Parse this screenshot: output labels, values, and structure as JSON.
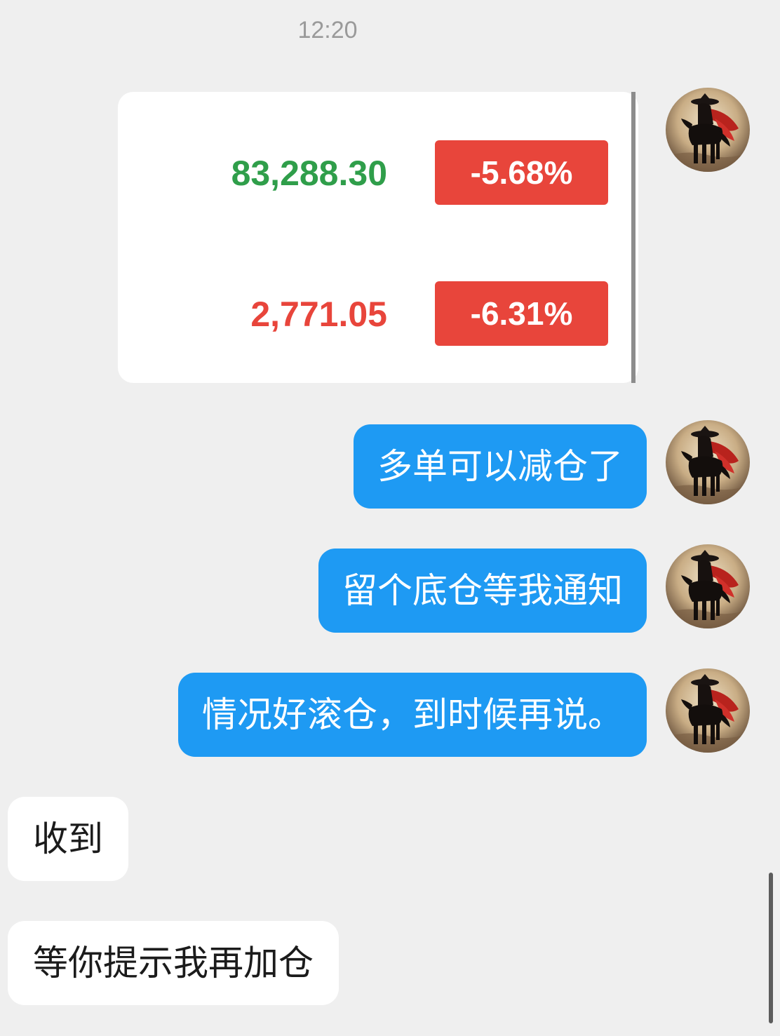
{
  "chat": {
    "timestamp": "12:20",
    "quote_card": {
      "rows": [
        {
          "value": "83,288.30",
          "value_color": "#2f9e4a",
          "change": "-5.68%"
        },
        {
          "value": "2,771.05",
          "value_color": "#e8453b",
          "change": "-6.31%"
        }
      ]
    },
    "messages": [
      {
        "direction": "outgoing",
        "text": "多单可以减仓了"
      },
      {
        "direction": "outgoing",
        "text": "留个底仓等我通知"
      },
      {
        "direction": "outgoing",
        "text": "情况好滚仓，到时候再说。"
      },
      {
        "direction": "incoming",
        "text": "收到"
      },
      {
        "direction": "incoming",
        "text": "等你提示我再加仓"
      }
    ],
    "avatar_icon": "horseman-avatar-icon"
  },
  "colors": {
    "background": "#efefef",
    "outgoing_bubble": "#1e9af3",
    "incoming_bubble": "#ffffff",
    "badge_red": "#e8453b",
    "price_green": "#2f9e4a"
  }
}
